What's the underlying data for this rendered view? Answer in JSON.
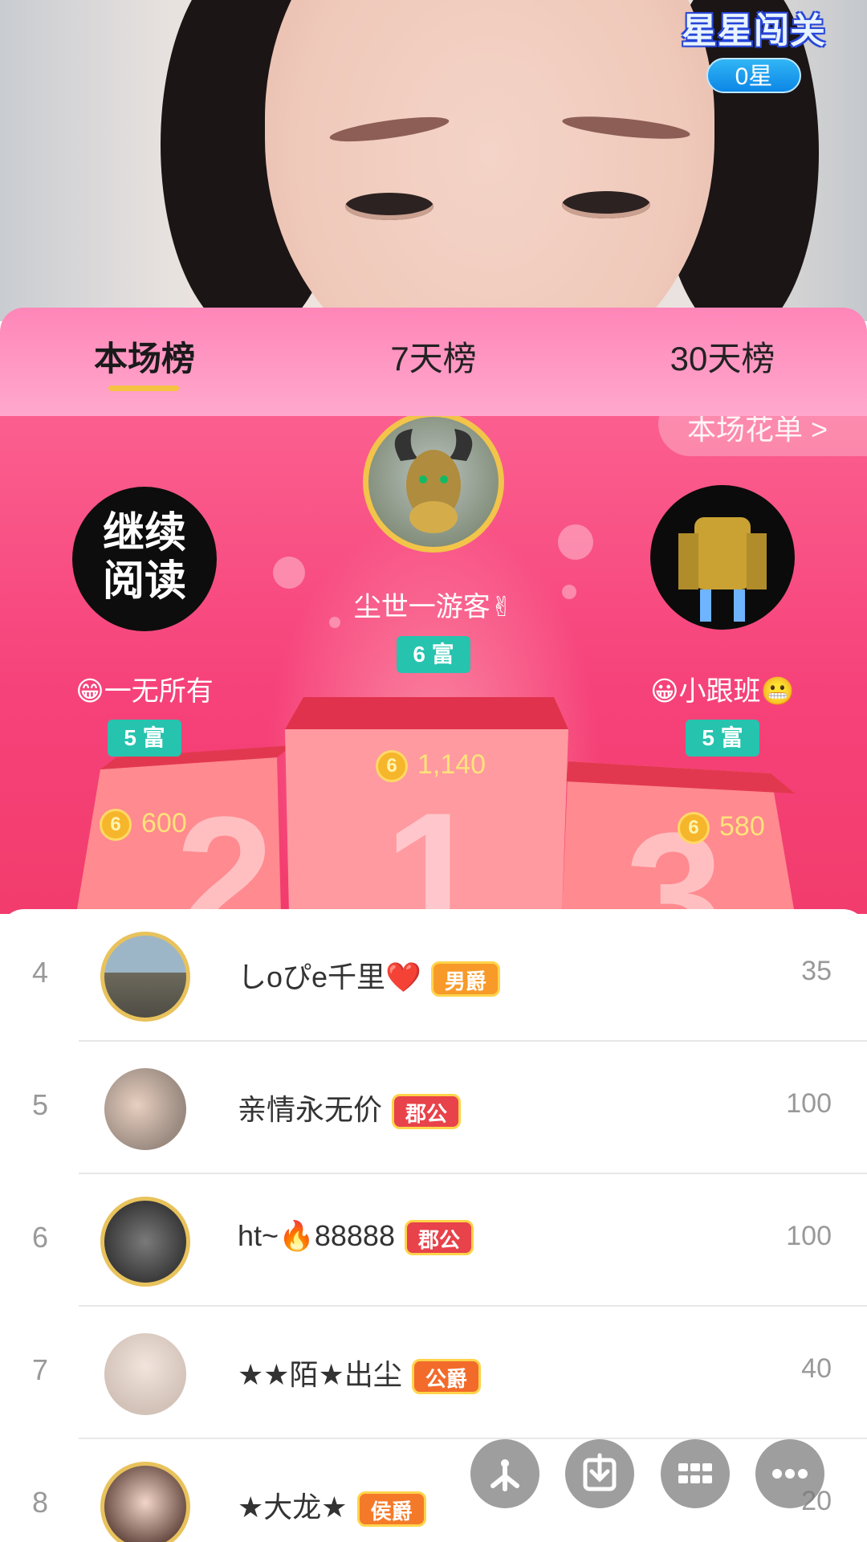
{
  "video": {
    "game_badge_title": "星星闯关",
    "game_badge_stars": "0星"
  },
  "tabs": [
    {
      "label": "本场榜",
      "active": true
    },
    {
      "label": "7天榜",
      "active": false
    },
    {
      "label": "30天榜",
      "active": false
    }
  ],
  "podium": {
    "link_label": "本场花单 >",
    "first": {
      "rank": "1",
      "name": "尘世一游客✌",
      "fu": "6 富",
      "coins": "1,140"
    },
    "second": {
      "rank": "2",
      "name": "😁一无所有",
      "fu": "5 富",
      "coins": "600",
      "avatar_text": "继续阅读"
    },
    "third": {
      "rank": "3",
      "name": "😀小跟班😬",
      "fu": "5 富",
      "coins": "580"
    },
    "coin_glyph": "6"
  },
  "list": [
    {
      "rank": "4",
      "name": "しoぴe千里❤️",
      "badge": "男爵",
      "badge_color": "#f79a2a",
      "score": "35"
    },
    {
      "rank": "5",
      "name": "亲情永无价",
      "badge": "郡公",
      "badge_color": "#e8424a",
      "score": "100"
    },
    {
      "rank": "6",
      "name": "ht~🔥88888",
      "badge": "郡公",
      "badge_color": "#e8424a",
      "score": "100"
    },
    {
      "rank": "7",
      "name": "★★陌★出尘",
      "badge": "公爵",
      "badge_color": "#f26b2b",
      "score": "40"
    },
    {
      "rank": "8",
      "name": "★大龙★",
      "badge": "侯爵",
      "badge_color": "#f47a2a",
      "score": "20"
    }
  ],
  "fab": [
    {
      "icon": "share-icon"
    },
    {
      "icon": "download-icon"
    },
    {
      "icon": "grid-icon"
    },
    {
      "icon": "more-icon"
    }
  ]
}
